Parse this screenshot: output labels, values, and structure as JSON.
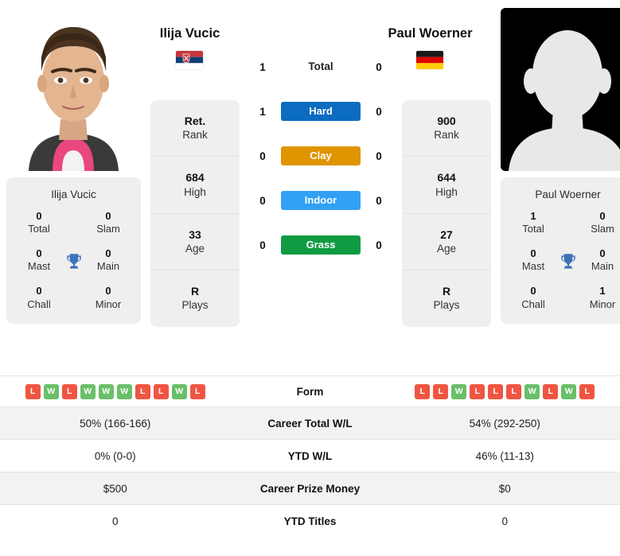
{
  "players": {
    "left": {
      "name": "Ilija Vucic",
      "flag": "serbia-flag",
      "photo": "player-headshot",
      "rank": "Ret.",
      "rank_label": "Rank",
      "high": "684",
      "high_label": "High",
      "age": "33",
      "age_label": "Age",
      "plays": "R",
      "plays_label": "Plays",
      "titles": {
        "card_name": "Ilija Vucic",
        "total": "0",
        "total_label": "Total",
        "slam": "0",
        "slam_label": "Slam",
        "mast": "0",
        "mast_label": "Mast",
        "main": "0",
        "main_label": "Main",
        "chall": "0",
        "chall_label": "Chall",
        "minor": "0",
        "minor_label": "Minor"
      },
      "form": [
        "L",
        "W",
        "L",
        "W",
        "W",
        "W",
        "L",
        "L",
        "W",
        "L"
      ],
      "career_total_wl": "50% (166-166)",
      "ytd_wl": "0% (0-0)",
      "career_prize_money": "$500",
      "ytd_titles": "0",
      "surface_counts": {
        "total": "1",
        "hard": "1",
        "clay": "0",
        "indoor": "0",
        "grass": "0"
      }
    },
    "right": {
      "name": "Paul Woerner",
      "flag": "germany-flag",
      "photo": "placeholder-avatar",
      "rank": "900",
      "rank_label": "Rank",
      "high": "644",
      "high_label": "High",
      "age": "27",
      "age_label": "Age",
      "plays": "R",
      "plays_label": "Plays",
      "titles": {
        "card_name": "Paul Woerner",
        "total": "1",
        "total_label": "Total",
        "slam": "0",
        "slam_label": "Slam",
        "mast": "0",
        "mast_label": "Mast",
        "main": "0",
        "main_label": "Main",
        "chall": "0",
        "chall_label": "Chall",
        "minor": "1",
        "minor_label": "Minor"
      },
      "form": [
        "L",
        "L",
        "W",
        "L",
        "L",
        "L",
        "W",
        "L",
        "W",
        "L"
      ],
      "career_total_wl": "54% (292-250)",
      "ytd_wl": "46% (11-13)",
      "career_prize_money": "$0",
      "ytd_titles": "0",
      "surface_counts": {
        "total": "0",
        "hard": "0",
        "clay": "0",
        "indoor": "0",
        "grass": "0"
      }
    }
  },
  "surfaces": [
    {
      "key": "total",
      "label": "Total",
      "color": "transparent",
      "text_color": "#212529"
    },
    {
      "key": "hard",
      "label": "Hard",
      "color": "#0b6cc0",
      "text_color": "#ffffff"
    },
    {
      "key": "clay",
      "label": "Clay",
      "color": "#e09400",
      "text_color": "#ffffff"
    },
    {
      "key": "indoor",
      "label": "Indoor",
      "color": "#31a0f5",
      "text_color": "#ffffff"
    },
    {
      "key": "grass",
      "label": "Grass",
      "color": "#109b42",
      "text_color": "#ffffff"
    }
  ],
  "table_rows": [
    {
      "key": "form",
      "label": "Form"
    },
    {
      "key": "career_total_wl",
      "label": "Career Total W/L"
    },
    {
      "key": "ytd_wl",
      "label": "YTD W/L"
    },
    {
      "key": "career_prize_money",
      "label": "Career Prize Money"
    },
    {
      "key": "ytd_titles",
      "label": "YTD Titles"
    }
  ],
  "colors": {
    "win": "#6abf69",
    "loss": "#ef5542",
    "card_bg": "#efefef",
    "row_alt_bg": "#f2f2f2",
    "trophy": "#3d72b8"
  },
  "icons": {
    "trophy": "trophy-icon"
  }
}
